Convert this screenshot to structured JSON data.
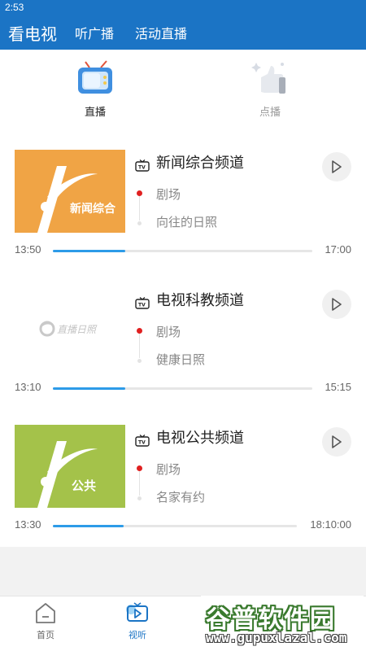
{
  "status": {
    "time": "2:53"
  },
  "header": {
    "tabs": [
      {
        "label": "看电视",
        "active": true
      },
      {
        "label": "听广播",
        "active": false
      },
      {
        "label": "活动直播",
        "active": false
      }
    ]
  },
  "modes": [
    {
      "label": "直播",
      "active": true,
      "icon": "tv-icon"
    },
    {
      "label": "点播",
      "active": false,
      "icon": "thumbs-up-icon"
    }
  ],
  "channels": [
    {
      "name": "新闻综合频道",
      "thumb_text": "新闻综合",
      "thumb_color": "#f0a445",
      "current": "剧场",
      "next": "向往的日照",
      "start": "13:50",
      "end": "17:00",
      "progress": 0.28
    },
    {
      "name": "电视科教频道",
      "thumb_text": "直播日照",
      "thumb_color": "#ffffff",
      "current": "剧场",
      "next": "健康日照",
      "start": "13:10",
      "end": "15:15",
      "progress": 0.28
    },
    {
      "name": "电视公共频道",
      "thumb_text": "公共",
      "thumb_color": "#a4c24a",
      "current": "剧场",
      "next": "名家有约",
      "start": "13:30",
      "end": "18:10:00",
      "progress": 0.29
    }
  ],
  "tabbar": [
    {
      "label": "首页",
      "icon": "home-icon",
      "active": false
    },
    {
      "label": "视听",
      "icon": "play-screen-icon",
      "active": true
    }
  ],
  "watermark": {
    "title": "谷普软件园",
    "url": "www.gupuxlazal.com"
  },
  "colors": {
    "primary": "#1b74c5",
    "accent_progress": "#2d9be8",
    "live_dot": "#e02020"
  }
}
